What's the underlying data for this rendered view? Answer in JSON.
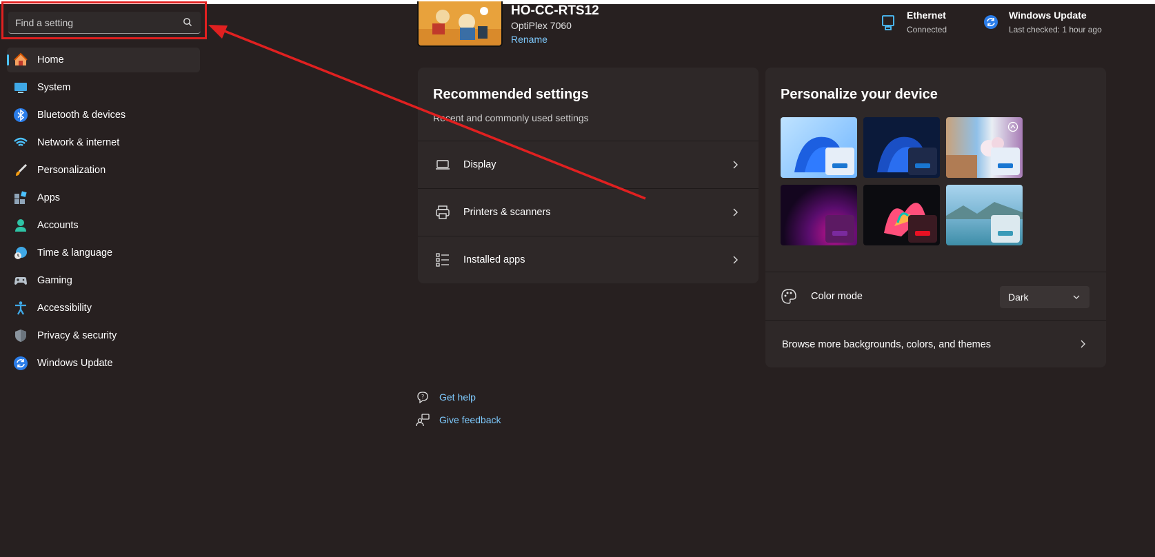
{
  "search": {
    "placeholder": "Find a setting",
    "icon": "search-icon"
  },
  "sidebar": {
    "items": [
      {
        "label": "Home",
        "icon": "home-icon",
        "active": true
      },
      {
        "label": "System",
        "icon": "monitor-icon"
      },
      {
        "label": "Bluetooth & devices",
        "icon": "bluetooth-icon"
      },
      {
        "label": "Network & internet",
        "icon": "wifi-icon"
      },
      {
        "label": "Personalization",
        "icon": "brush-icon"
      },
      {
        "label": "Apps",
        "icon": "apps-icon"
      },
      {
        "label": "Accounts",
        "icon": "person-icon"
      },
      {
        "label": "Time & language",
        "icon": "globe-clock-icon"
      },
      {
        "label": "Gaming",
        "icon": "gamepad-icon"
      },
      {
        "label": "Accessibility",
        "icon": "accessibility-icon"
      },
      {
        "label": "Privacy & security",
        "icon": "shield-icon"
      },
      {
        "label": "Windows Update",
        "icon": "refresh-icon"
      }
    ]
  },
  "device": {
    "name": "HO-CC-RTS12",
    "model": "OptiPlex 7060",
    "rename_label": "Rename"
  },
  "status": {
    "ethernet": {
      "title": "Ethernet",
      "sub": "Connected"
    },
    "update": {
      "title": "Windows Update",
      "sub": "Last checked: 1 hour ago"
    }
  },
  "recommended": {
    "title": "Recommended settings",
    "subtitle": "Recent and commonly used settings",
    "rows": [
      {
        "label": "Display",
        "icon": "laptop-icon"
      },
      {
        "label": "Printers & scanners",
        "icon": "printer-icon"
      },
      {
        "label": "Installed apps",
        "icon": "list-icon"
      }
    ]
  },
  "personalize": {
    "title": "Personalize your device",
    "color_mode_label": "Color mode",
    "color_mode_value": "Dark",
    "browse_label": "Browse more backgrounds, colors, and themes"
  },
  "help": {
    "get_help": "Get help",
    "give_feedback": "Give feedback"
  },
  "colors": {
    "accent": "#4cc2ff",
    "link": "#7fcbff",
    "annotation": "#e02020",
    "background": "#272020"
  }
}
